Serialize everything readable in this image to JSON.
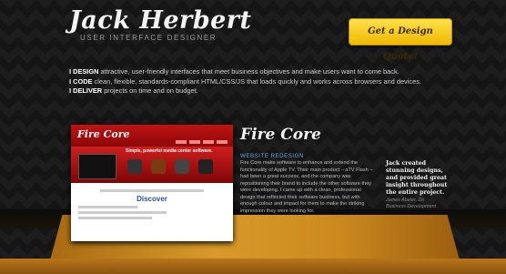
{
  "header": {
    "logo": "Jack Herbert",
    "tagline": "USER INTERFACE DESIGNER",
    "cta_label": "Get a Design Quote!"
  },
  "intro": [
    {
      "verb": "I DESIGN",
      "text": " attractive, user-friendly interfaces that meet business objectives and make users want to come back."
    },
    {
      "verb": "I CODE",
      "text": " clean, flexible, standards-compliant HTML/CSS/JS that loads quickly and works across browsers and devices."
    },
    {
      "verb": "I DELIVER",
      "text": " projects on time and on budget."
    }
  ],
  "project": {
    "title": "Fire Core",
    "subtitle": "WEBSITE REDESIGN",
    "description": "Fire Core make software to enhance and extend the functionality of Apple TV. Their main product – aTV Flash – had been a great success, and the company was repositioning their brand to include the other software they were developing. I came up with a clean, professional design that reflected their software business, but with enough colour and impact for them to make the striking impression they were looking for.",
    "testimonial": "Jack created stunning designs, and provided great insight throughout the entire project.",
    "attribution_name": "James Abeler, Dir",
    "attribution_role": "Business Development"
  },
  "screenshot": {
    "brand": "Fire Core",
    "banner_text": "Simple, powerful media center software.",
    "cta_text": "Discover"
  },
  "colors": {
    "accent_yellow": "#f5c400",
    "subtitle_blue": "#6fa7d8",
    "wood": "#c98a22",
    "site_red": "#c01313"
  }
}
